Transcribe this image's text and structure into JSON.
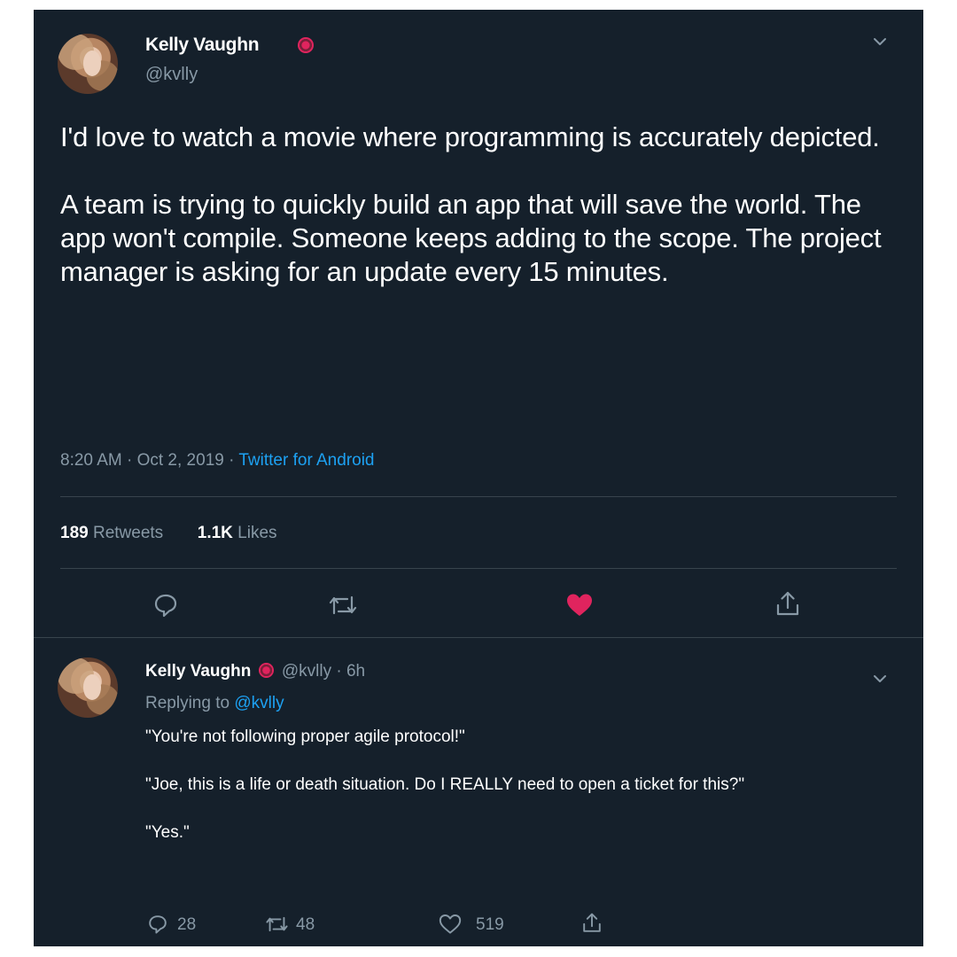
{
  "tweet": {
    "author_name": "Kelly Vaughn",
    "author_handle": "@kvlly",
    "text": "I'd love to watch a movie where programming is accurately depicted.\n\nA team is trying to quickly build an app that will save the world. The app won't compile. Someone keeps adding to the scope. The project manager is asking for an update every 15 minutes.",
    "time": "8:20 AM · Oct 2, 2019 · ",
    "source": "Twitter for Android",
    "retweets_count": "189",
    "retweets_label": "Retweets",
    "likes_count": "1.1K",
    "likes_label": "Likes",
    "icons": [
      "reply-icon",
      "retweet-icon",
      "like-icon",
      "share-icon"
    ],
    "liked_color": "#e0245e"
  },
  "reply": {
    "author_name": "Kelly Vaughn",
    "author_handle_time": "@kvlly · 6h",
    "replying_label": "Replying to ",
    "replying_handle": "@kvlly",
    "text": "\"You're not following proper agile protocol!\"\n\n\"Joe, this is a life or death situation. Do I REALLY need to open a ticket for this?\"\n\n\"Yes.\"",
    "reply_count": "28",
    "retweet_count": "48",
    "like_count": "519"
  },
  "colors": {
    "background": "#15202b",
    "secondary_text": "#8899a6",
    "link": "#1da1f2",
    "divider": "#38444d"
  }
}
